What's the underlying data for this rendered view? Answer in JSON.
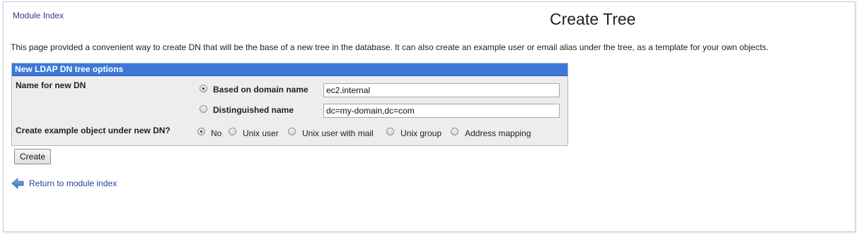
{
  "header": {
    "module_index_link": "Module Index",
    "title": "Create Tree"
  },
  "description": "This page provided a convenient way to create DN that will be the base of a new tree in the database. It can also create an example user or email alias under the tree, as a template for your own objects.",
  "form": {
    "section_title": "New LDAP DN tree options",
    "name_label": "Name for new DN",
    "dn_options": [
      {
        "label": "Based on domain name",
        "value": "ec2.internal",
        "selected": true
      },
      {
        "label": "Distinguished name",
        "value": "dc=my-domain,dc=com",
        "selected": false
      }
    ],
    "example_label": "Create example object under new DN?",
    "example_options": [
      {
        "label": "No",
        "selected": true
      },
      {
        "label": "Unix user",
        "selected": false
      },
      {
        "label": "Unix user with mail",
        "selected": false
      },
      {
        "label": "Unix group",
        "selected": false
      },
      {
        "label": "Address mapping",
        "selected": false
      }
    ],
    "submit_label": "Create"
  },
  "footer": {
    "return_link": "Return to module index",
    "return_icon": "back-arrow-icon"
  },
  "colors": {
    "header_bg": "#3c78d8",
    "link": "#2a3c9a",
    "panel_bg": "#ededed"
  }
}
